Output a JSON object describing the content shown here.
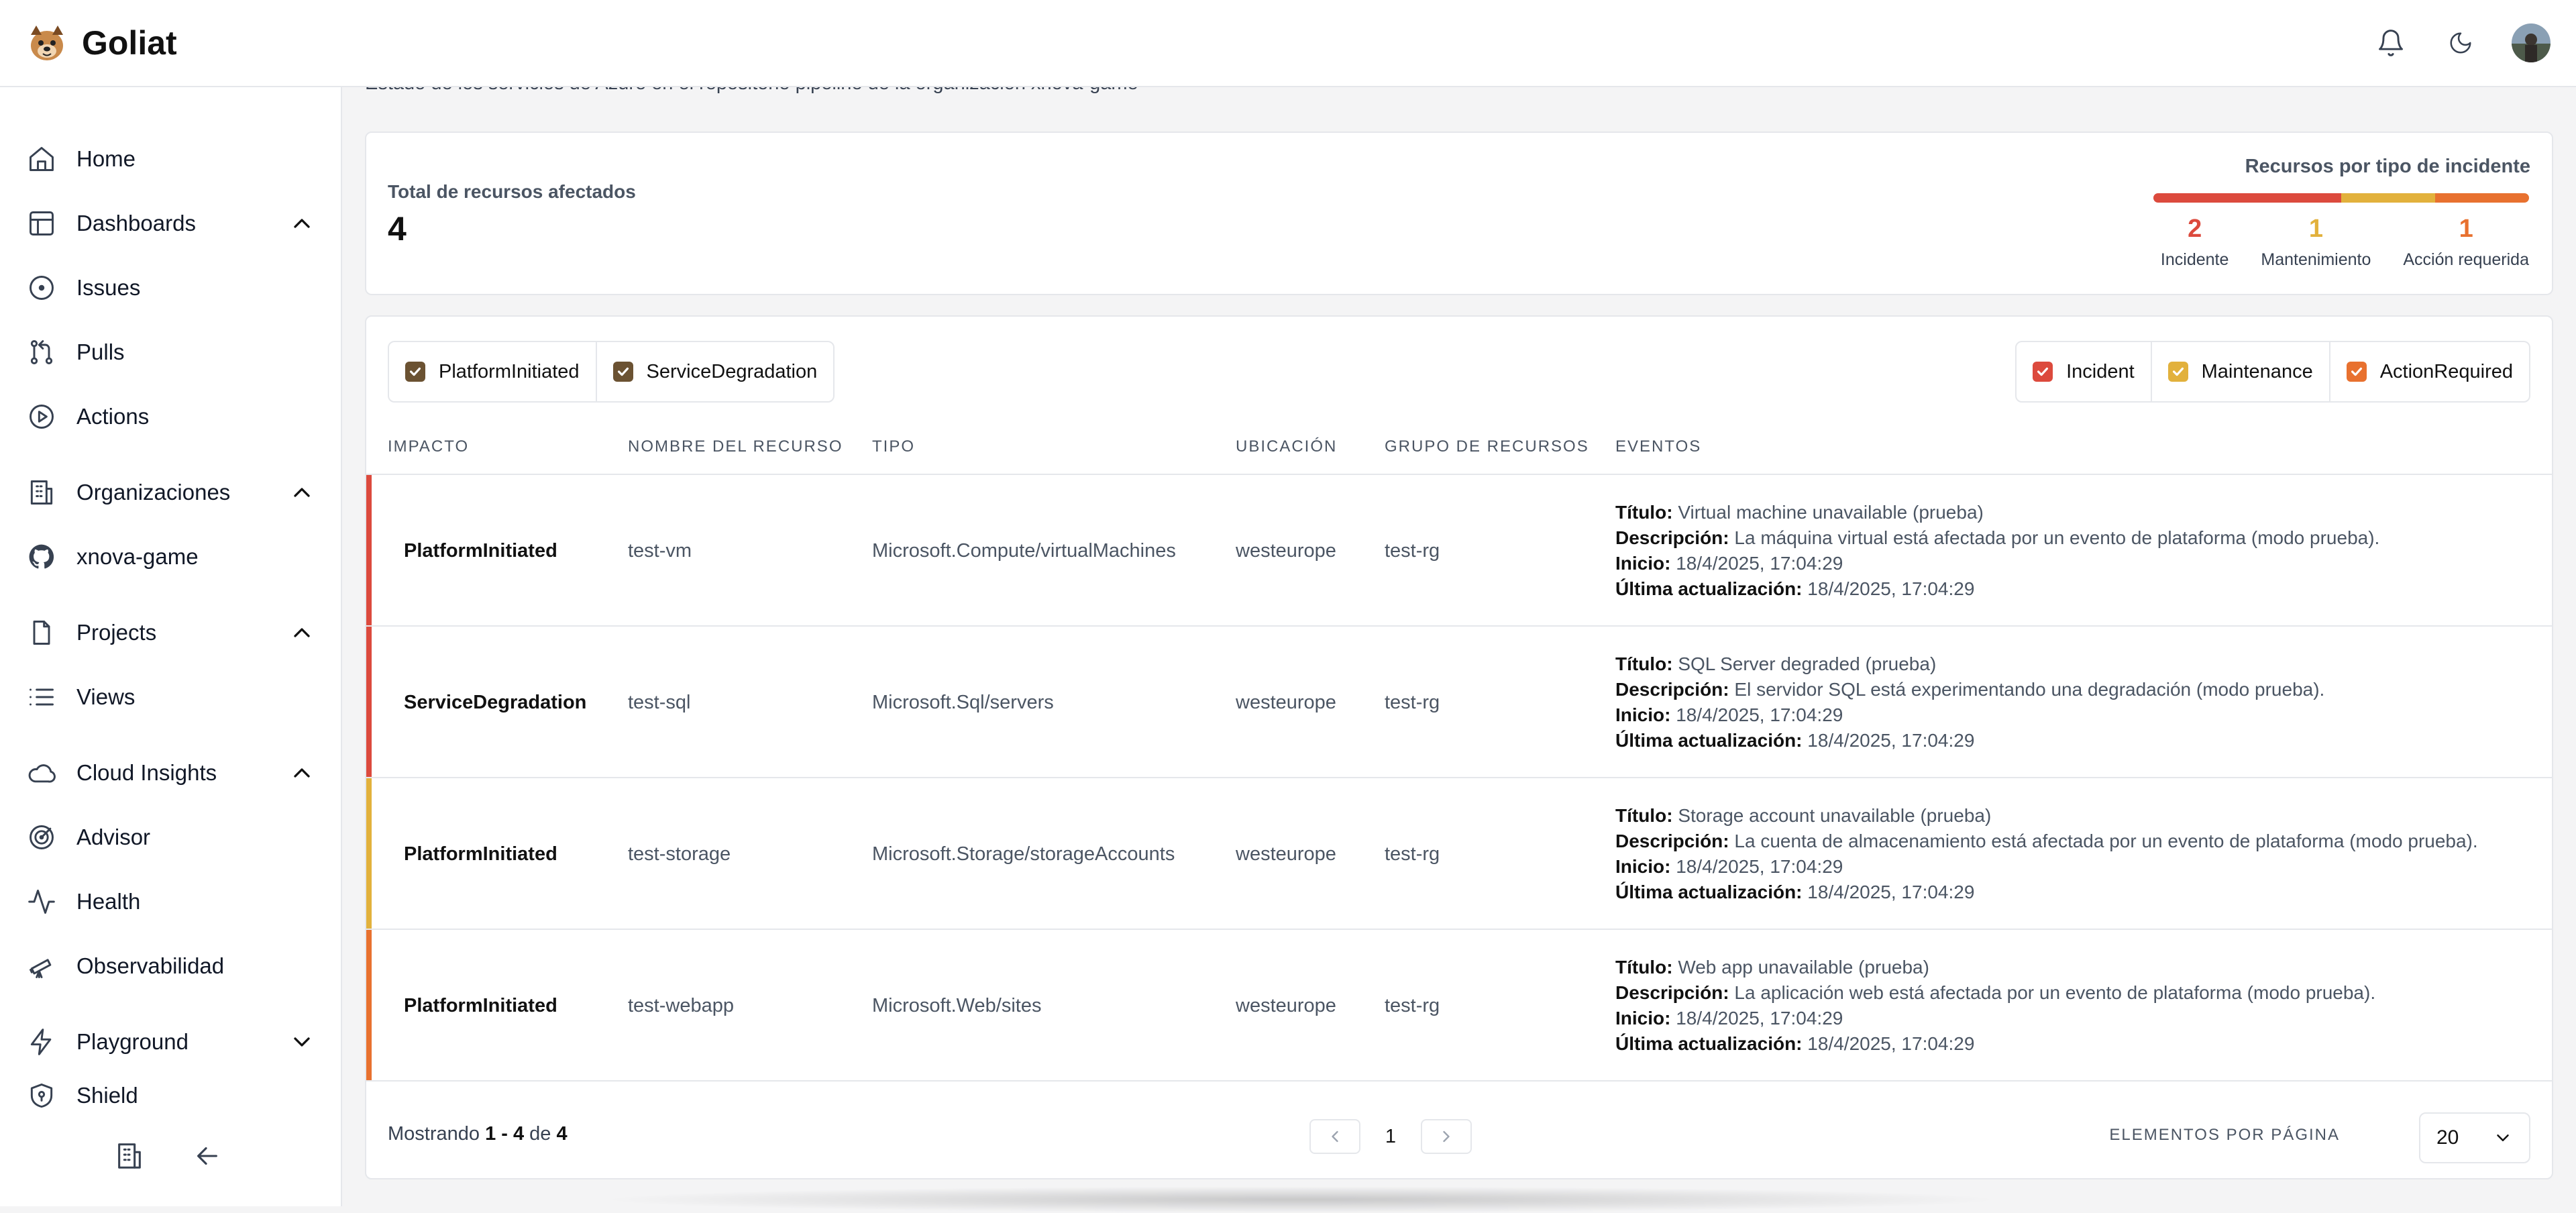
{
  "app": {
    "title": "Goliat"
  },
  "colors": {
    "incident": "#dc4a3d",
    "maintenance": "#e2b13c",
    "action_required": "#e8712f",
    "checkbox_neutral": "#6b5232"
  },
  "sidebar": {
    "items": [
      {
        "label": "Home",
        "icon": "home-icon"
      },
      {
        "label": "Dashboards",
        "icon": "dashboard-icon",
        "expanded": true
      },
      {
        "label": "Issues",
        "icon": "issues-icon"
      },
      {
        "label": "Pulls",
        "icon": "pull-request-icon"
      },
      {
        "label": "Actions",
        "icon": "play-icon"
      },
      {
        "label": "Organizaciones",
        "icon": "building-icon",
        "expanded": true
      },
      {
        "label": "xnova-game",
        "icon": "github-icon"
      },
      {
        "label": "Projects",
        "icon": "file-icon",
        "expanded": true
      },
      {
        "label": "Views",
        "icon": "list-icon"
      },
      {
        "label": "Cloud Insights",
        "icon": "cloud-icon",
        "expanded": true
      },
      {
        "label": "Advisor",
        "icon": "target-icon"
      },
      {
        "label": "Health",
        "icon": "activity-icon"
      },
      {
        "label": "Observabilidad",
        "icon": "telescope-icon"
      },
      {
        "label": "Playground",
        "icon": "bolt-icon",
        "expanded": false
      },
      {
        "label": "Shield",
        "icon": "shield-icon"
      }
    ]
  },
  "main": {
    "subtitle": "Estado de los servicios de Azure en el repositorio pipeline de la organización xnova-game",
    "summary": {
      "total_label": "Total de recursos afectados",
      "total_value": "4",
      "by_type_title": "Recursos por tipo de incidente",
      "counts": [
        {
          "value": "2",
          "label": "Incidente",
          "fraction": 0.5
        },
        {
          "value": "1",
          "label": "Mantenimiento",
          "fraction": 0.25
        },
        {
          "value": "1",
          "label": "Acción requerida",
          "fraction": 0.25
        }
      ]
    },
    "filters_left": [
      {
        "label": "PlatformInitiated",
        "checked": true
      },
      {
        "label": "ServiceDegradation",
        "checked": true
      }
    ],
    "filters_right": [
      {
        "label": "Incident",
        "checked": true
      },
      {
        "label": "Maintenance",
        "checked": true
      },
      {
        "label": "ActionRequired",
        "checked": true
      }
    ],
    "columns": [
      "Impacto",
      "Nombre del recurso",
      "Tipo",
      "Ubicación",
      "Grupo de recursos",
      "Eventos"
    ],
    "rows": [
      {
        "impact": "PlatformInitiated",
        "name": "test-vm",
        "type": "Microsoft.Compute/virtualMachines",
        "location": "westeurope",
        "group": "test-rg",
        "severity": "incident",
        "title_label": "Título:",
        "title": "Virtual machine unavailable (prueba)",
        "desc_label": "Descripción:",
        "desc": "La máquina virtual está afectada por un evento de plataforma (modo prueba).",
        "start_label": "Inicio:",
        "start": "18/4/2025, 17:04:29",
        "update_label": "Última actualización:",
        "update": "18/4/2025, 17:04:29"
      },
      {
        "impact": "ServiceDegradation",
        "name": "test-sql",
        "type": "Microsoft.Sql/servers",
        "location": "westeurope",
        "group": "test-rg",
        "severity": "incident",
        "title_label": "Título:",
        "title": "SQL Server degraded (prueba)",
        "desc_label": "Descripción:",
        "desc": "El servidor SQL está experimentando una degradación (modo prueba).",
        "start_label": "Inicio:",
        "start": "18/4/2025, 17:04:29",
        "update_label": "Última actualización:",
        "update": "18/4/2025, 17:04:29"
      },
      {
        "impact": "PlatformInitiated",
        "name": "test-storage",
        "type": "Microsoft.Storage/storageAccounts",
        "location": "westeurope",
        "group": "test-rg",
        "severity": "maintenance",
        "title_label": "Título:",
        "title": "Storage account unavailable (prueba)",
        "desc_label": "Descripción:",
        "desc": "La cuenta de almacenamiento está afectada por un evento de plataforma (modo prueba).",
        "start_label": "Inicio:",
        "start": "18/4/2025, 17:04:29",
        "update_label": "Última actualización:",
        "update": "18/4/2025, 17:04:29"
      },
      {
        "impact": "PlatformInitiated",
        "name": "test-webapp",
        "type": "Microsoft.Web/sites",
        "location": "westeurope",
        "group": "test-rg",
        "severity": "action_required",
        "title_label": "Título:",
        "title": "Web app unavailable (prueba)",
        "desc_label": "Descripción:",
        "desc": "La aplicación web está afectada por un evento de plataforma (modo prueba).",
        "start_label": "Inicio:",
        "start": "18/4/2025, 17:04:29",
        "update_label": "Última actualización:",
        "update": "18/4/2025, 17:04:29"
      }
    ],
    "pagination": {
      "showing_prefix": "Mostrando",
      "range": "1 - 4",
      "of": "de",
      "total": "4",
      "current_page": "1",
      "per_page_label": "Elementos por página",
      "per_page_value": "20"
    }
  }
}
